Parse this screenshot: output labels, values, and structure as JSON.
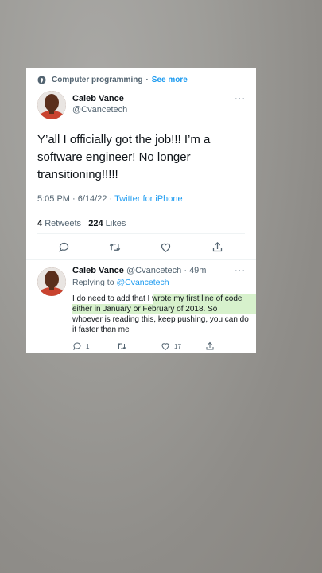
{
  "topic": {
    "label": "Computer programming",
    "separator": "·",
    "see_more": "See more"
  },
  "main_tweet": {
    "author_name": "Caleb Vance",
    "author_handle": "@Cvancetech",
    "text": "Y’all I officially got the job!!! I’m a software engineer! No longer transitioning!!!!!",
    "time": "5:05 PM",
    "date": "6/14/22",
    "source": "Twitter for iPhone",
    "retweets_count": "4",
    "retweets_label": "Retweets",
    "likes_count": "224",
    "likes_label": "Likes",
    "more_glyph": "···"
  },
  "reply_tweet": {
    "author_name": "Caleb Vance",
    "author_handle": "@Cvancetech",
    "age": "49m",
    "replying_to_label": "Replying to",
    "replying_to_handle": "@Cvancetech",
    "text": "I do need to add that I wrote my first line of code either in January or February of 2018. So whoever is reading this, keep pushing, you can do it faster than me",
    "reply_count": "1",
    "retweet_count": "",
    "like_count": "17",
    "more_glyph": "···"
  },
  "colors": {
    "accent": "#1d9bf0",
    "highlight": "#c9ecbb",
    "text": "#0f1419",
    "secondary": "#536471"
  },
  "icons": [
    "location-pin-icon",
    "reply-icon",
    "retweet-icon",
    "like-icon",
    "share-icon"
  ]
}
